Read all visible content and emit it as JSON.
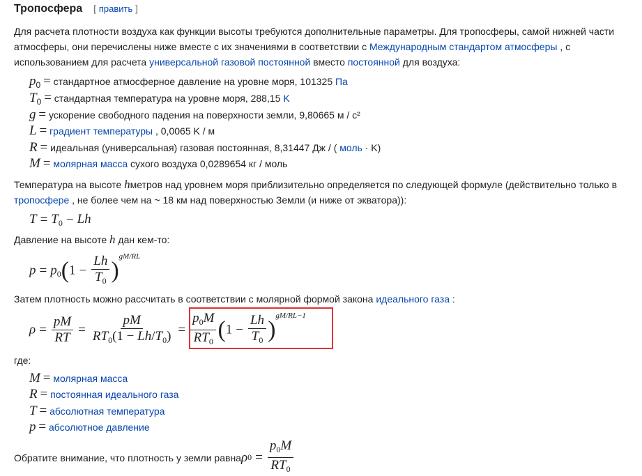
{
  "heading": {
    "title": "Тропосфера",
    "edit_open": "[",
    "edit_label": "править",
    "edit_close": "]"
  },
  "intro": {
    "t1": "Для расчета плотности воздуха как функции высоты требуются дополнительные параметры. Для тропосферы, самой нижней части атмосферы, они перечислены ниже вместе с их значениями в соответствии с ",
    "link1": "Международным стандартом атмосферы",
    "t2": " , с использованием для расчета ",
    "link2": "универсальной газовой постоянной",
    "t3": " вместо ",
    "link3": "постоянной",
    "t4": " для воздуха:"
  },
  "params": [
    {
      "sym": "p",
      "sub": "0",
      "text": " стандартное атмосферное давление на уровне моря, 101325 ",
      "link": "Па",
      "after": ""
    },
    {
      "sym": "T",
      "sub": "0",
      "text": " стандартная температура на уровне моря, 288,15 ",
      "link": "K",
      "after": ""
    },
    {
      "sym": "g",
      "sub": "",
      "text": " ускорение свободного падения на поверхности земли, 9,80665 м / с²",
      "link": "",
      "after": ""
    },
    {
      "sym": "L",
      "sub": "",
      "text": " ",
      "link": "градиент температуры",
      "after": " , 0,0065 K / м"
    },
    {
      "sym": "R",
      "sub": "",
      "text": " идеальная (универсальная) газовая постоянная, 8,31447 Дж / ( ",
      "link": "моль",
      "after": " · K)"
    },
    {
      "sym": "M",
      "sub": "",
      "text": " ",
      "link": "молярная масса",
      "after": " сухого воздуха 0,0289654 кг / моль"
    }
  ],
  "temp_par": {
    "t1": "Температура на высоте ",
    "var": "h",
    "t2": "метров над уровнем моря приблизительно определяется по следующей формуле (действительно только в ",
    "link": "тропосфере",
    "t3": " , не более чем на ~ 18 км над поверхностью Земли (и ниже от экватора)):"
  },
  "formula_T": "T = T₀ − Lh",
  "pressure_par": {
    "t1": "Давление на высоте ",
    "var": "h",
    "t2": " дан кем-то:"
  },
  "exponent1": "gM/RL",
  "density_par": {
    "t1": "Затем плотность можно рассчитать в соответствии с молярной формой закона ",
    "link": "идеального газа",
    "t2": " :"
  },
  "exponent2": "gM/RL−1",
  "where_label": "где:",
  "where_items": [
    {
      "sym": "M",
      "link": "молярная масса"
    },
    {
      "sym": "R",
      "link": "постоянная идеального газа"
    },
    {
      "sym": "T",
      "link": "абсолютная температура"
    },
    {
      "sym": "p",
      "link": "абсолютное давление"
    }
  ],
  "final_par": {
    "t1": "Обратите внимание, что плотность у земли равна "
  },
  "highlight_color": "#dd3333",
  "link_color": "#0645ad"
}
